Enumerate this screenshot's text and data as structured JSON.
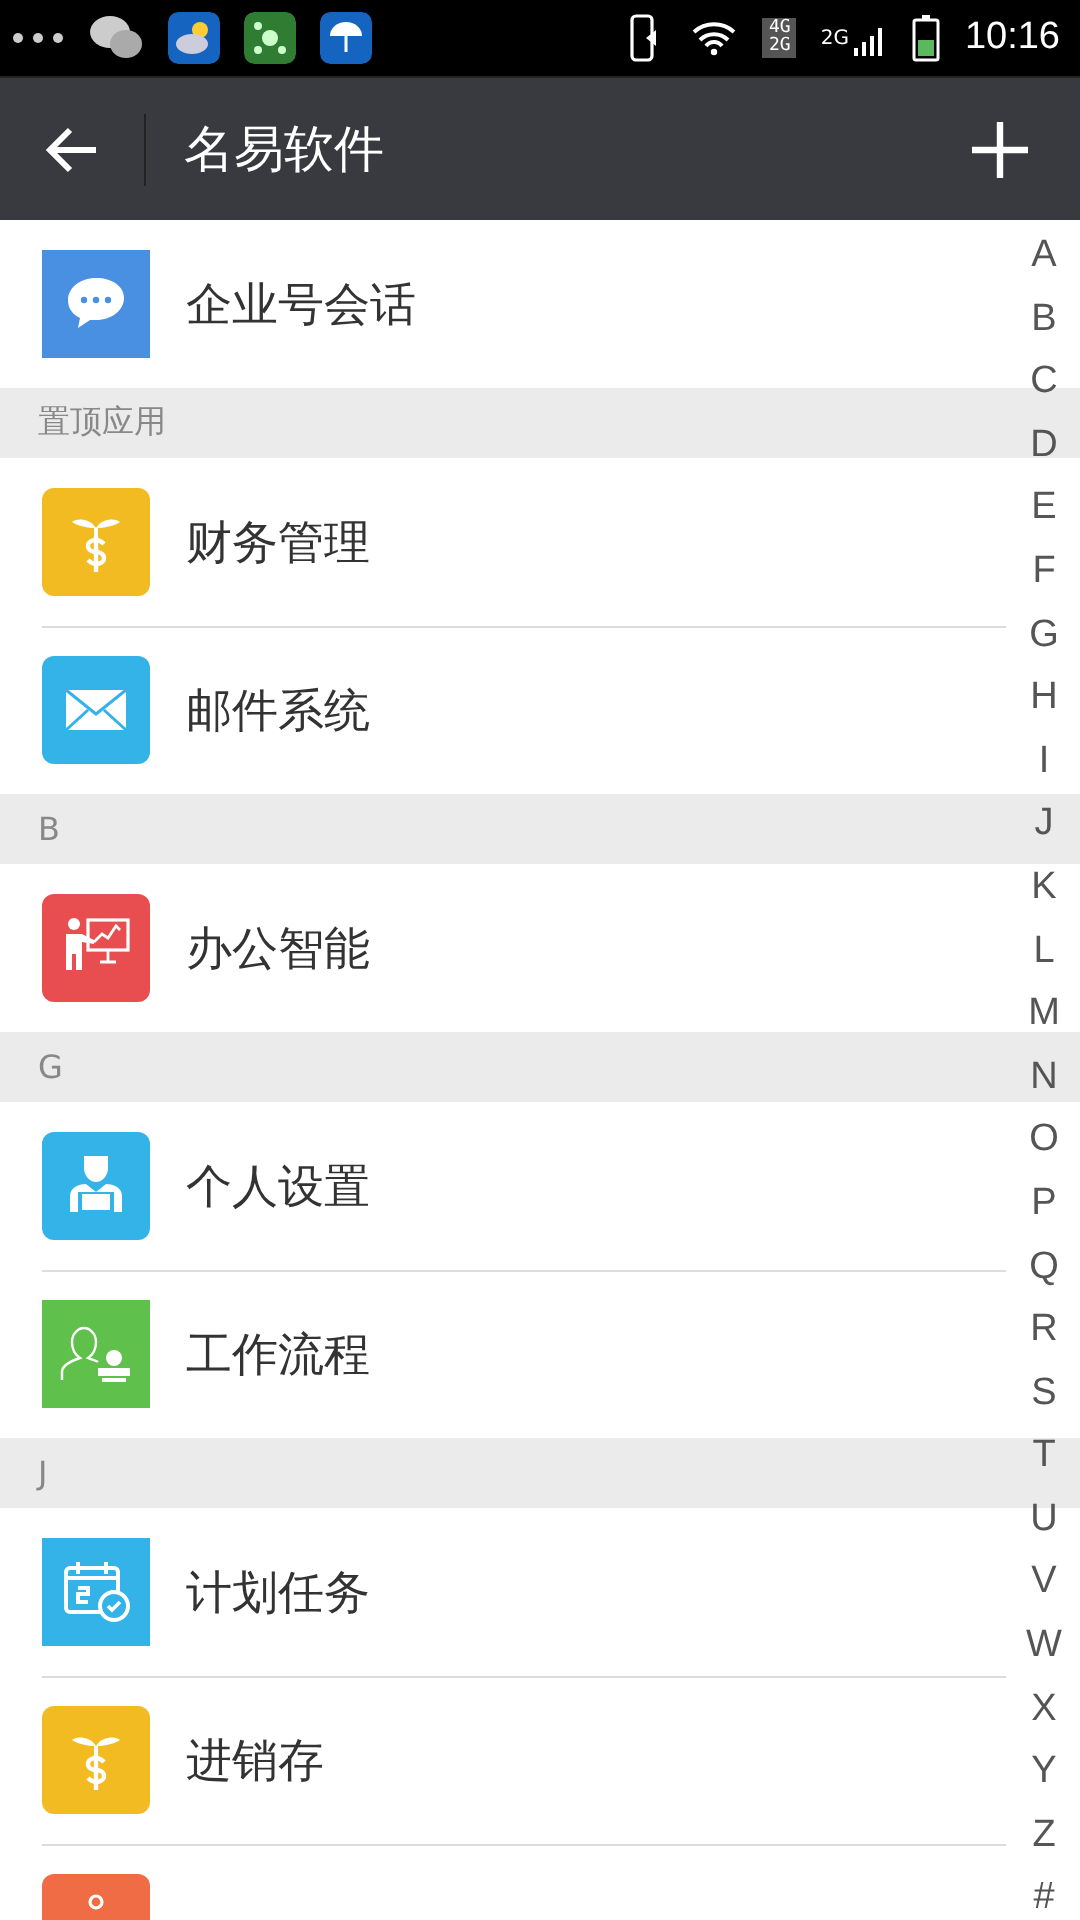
{
  "status_bar": {
    "network_badge": [
      "4G",
      "2G"
    ],
    "network_label": "2G",
    "time": "10:16"
  },
  "app_bar": {
    "title": "名易软件"
  },
  "sections": [
    {
      "items": [
        {
          "kind": "chat",
          "label": "企业号会话"
        }
      ]
    },
    {
      "header": "置顶应用",
      "items": [
        {
          "kind": "money",
          "label": "财务管理"
        },
        {
          "kind": "mail",
          "label": "邮件系统"
        }
      ]
    },
    {
      "header": "B",
      "items": [
        {
          "kind": "presenter",
          "label": "办公智能"
        }
      ]
    },
    {
      "header": "G",
      "items": [
        {
          "kind": "person",
          "label": "个人设置"
        },
        {
          "kind": "contact",
          "label": "工作流程"
        }
      ]
    },
    {
      "header": "J",
      "items": [
        {
          "kind": "calendar",
          "label": "计划任务"
        },
        {
          "kind": "money",
          "label": "进销存"
        },
        {
          "kind": "alarm"
        }
      ]
    }
  ],
  "index": [
    "A",
    "B",
    "C",
    "D",
    "E",
    "F",
    "G",
    "H",
    "I",
    "J",
    "K",
    "L",
    "M",
    "N",
    "O",
    "P",
    "Q",
    "R",
    "S",
    "T",
    "U",
    "V",
    "W",
    "X",
    "Y",
    "Z",
    "#"
  ]
}
